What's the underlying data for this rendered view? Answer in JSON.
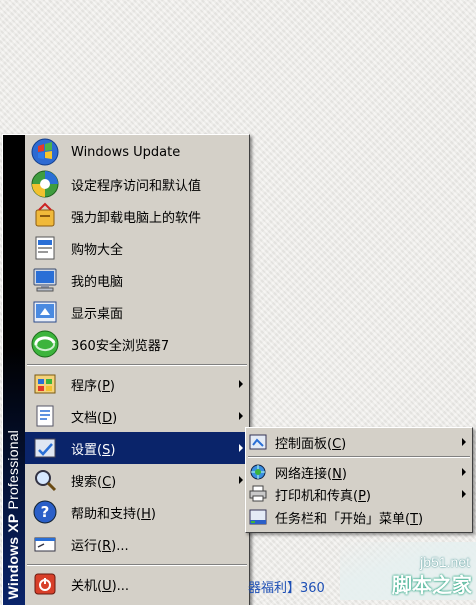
{
  "banner": {
    "brand": "Windows XP",
    "edition": "Professional"
  },
  "pinned": [
    {
      "label": "Windows Update",
      "icon": "windows-update-icon"
    },
    {
      "label": "设定程序访问和默认值",
      "icon": "program-access-icon"
    },
    {
      "label": "强力卸载电脑上的软件",
      "icon": "uninstall-icon"
    },
    {
      "label": "购物大全",
      "icon": "shopping-icon"
    },
    {
      "label": "我的电脑",
      "icon": "my-computer-icon"
    },
    {
      "label": "显示桌面",
      "icon": "show-desktop-icon"
    },
    {
      "label": "360安全浏览器7",
      "icon": "browser-360-icon"
    }
  ],
  "system_items": [
    {
      "label": "程序(",
      "acc": "P",
      "tail": ")",
      "icon": "programs-icon",
      "submenu": true
    },
    {
      "label": "文档(",
      "acc": "D",
      "tail": ")",
      "icon": "documents-icon",
      "submenu": true
    },
    {
      "label": "设置(",
      "acc": "S",
      "tail": ")",
      "icon": "settings-icon",
      "submenu": true,
      "highlighted": true
    },
    {
      "label": "搜索(",
      "acc": "C",
      "tail": ")",
      "icon": "search-icon",
      "submenu": true
    },
    {
      "label": "帮助和支持(",
      "acc": "H",
      "tail": ")",
      "icon": "help-icon",
      "submenu": false
    },
    {
      "label": "运行(",
      "acc": "R",
      "tail": ")...",
      "icon": "run-icon",
      "submenu": false
    }
  ],
  "shutdown": {
    "label": "关机(",
    "acc": "U",
    "tail": ")...",
    "icon": "shutdown-icon"
  },
  "settings_submenu": [
    {
      "label": "控制面板(",
      "acc": "C",
      "tail": ")",
      "icon": "control-panel-icon",
      "submenu": true
    },
    {
      "label": "网络连接(",
      "acc": "N",
      "tail": ")",
      "icon": "network-icon",
      "submenu": true
    },
    {
      "label": "打印机和传真(",
      "acc": "P",
      "tail": ")",
      "icon": "printer-icon",
      "submenu": true
    },
    {
      "label": "任务栏和「开始」菜单(",
      "acc": "T",
      "tail": ")",
      "icon": "taskbar-icon",
      "submenu": false
    }
  ],
  "background_text": "器福利】360",
  "watermark": {
    "url": "jb51.net",
    "name": "脚本之家"
  },
  "colors": {
    "menu_bg": "#d4d0c8",
    "highlight": "#0a246a",
    "banner": "#000000"
  }
}
